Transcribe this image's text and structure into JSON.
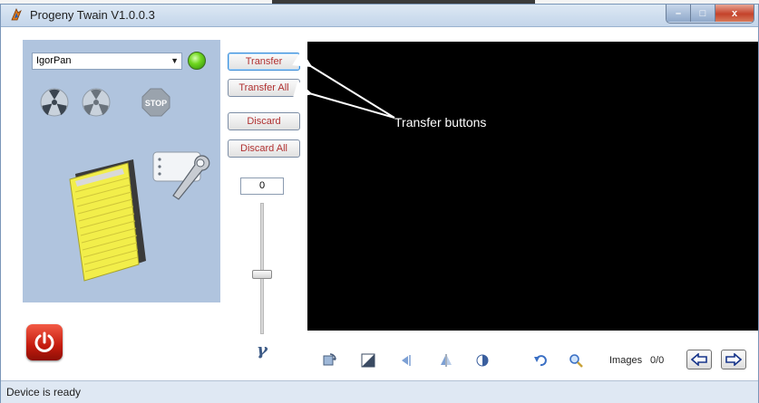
{
  "window": {
    "title": "Progeny Twain V1.0.0.3",
    "minimize": "–",
    "maximize": "□",
    "close": "x"
  },
  "device": {
    "selected": "IgorPan"
  },
  "buttons": {
    "transfer": "Transfer",
    "transfer_all": "Transfer All",
    "discard": "Discard",
    "discard_all": "Discard All"
  },
  "slider": {
    "value": "0",
    "symbol": "γ",
    "level": 0.55
  },
  "annotation": {
    "text": "Transfer buttons"
  },
  "images": {
    "label": "Images",
    "count": "0/0"
  },
  "status": {
    "text": "Device is ready"
  },
  "colors": {
    "panel": "#b0c4de",
    "preview_bg": "#000000",
    "led": "#6fd61e",
    "power": "#c41b0e",
    "notebook": "#f2ee4a"
  },
  "icons": [
    "app-icon",
    "dropdown-arrow-icon",
    "status-led-icon",
    "scan-icon",
    "scan-preview-icon",
    "stop-icon",
    "scanner-icon",
    "settings-wrench-icon",
    "power-icon",
    "rotate-icon",
    "contrast-icon",
    "flip-horizontal-icon",
    "mirror-icon",
    "brightness-icon",
    "undo-icon",
    "zoom-icon",
    "arrow-left-icon",
    "arrow-right-icon"
  ]
}
